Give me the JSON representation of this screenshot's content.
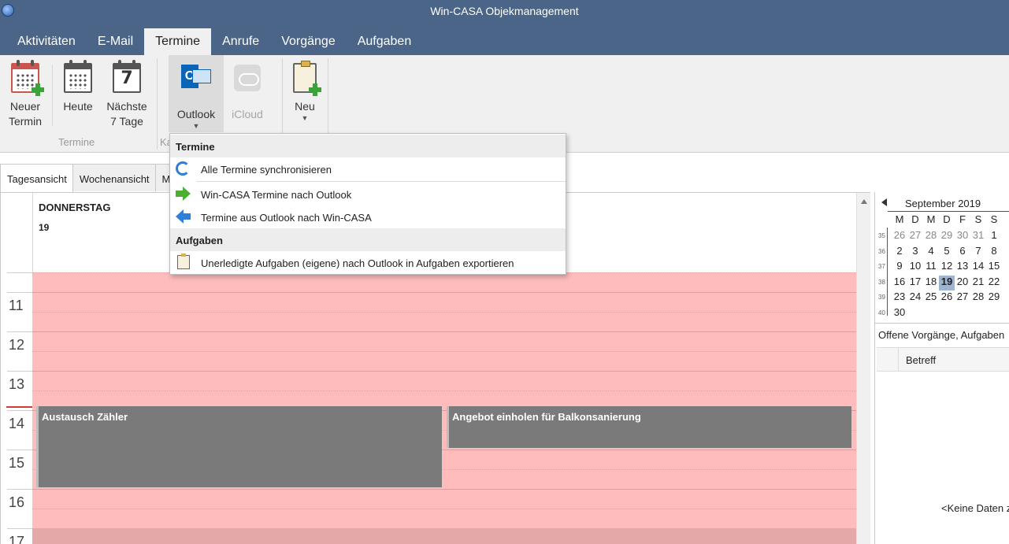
{
  "window": {
    "title": "Win-CASA Objekmanagement"
  },
  "tabs": [
    {
      "label": "Aktivitäten"
    },
    {
      "label": "E-Mail"
    },
    {
      "label": "Termine"
    },
    {
      "label": "Anrufe"
    },
    {
      "label": "Vorgänge"
    },
    {
      "label": "Aufgaben"
    }
  ],
  "ribbon": {
    "new_appointment": "Neuer Termin",
    "today": "Heute",
    "next7": "Nächste 7 Tage",
    "next7_icon_number": "7",
    "group_termine": "Termine",
    "outlook": "Outlook",
    "icloud": "iCloud",
    "group_partial": "Ka",
    "neu": "Neu"
  },
  "dropdown": {
    "section1": "Termine",
    "item_sync": "Alle Termine synchronisieren",
    "item_to_outlook": "Win-CASA Termine nach Outlook",
    "item_from_outlook": "Termine aus Outlook nach Win-CASA",
    "section2": "Aufgaben",
    "item_tasks_export": "Unerledigte Aufgaben (eigene) nach Outlook in Aufgaben exportieren"
  },
  "viewtabs": [
    {
      "label": "Tagesansicht"
    },
    {
      "label": "Wochenansicht"
    },
    {
      "label": "M"
    }
  ],
  "day": {
    "name": "DONNERSTAG",
    "number": "19",
    "hours": [
      "11",
      "12",
      "13",
      "14",
      "15",
      "16",
      "17"
    ]
  },
  "appointments": [
    {
      "title": "Austausch Zähler"
    },
    {
      "title": "Angebot einholen für Balkonsanierung"
    }
  ],
  "minicalendar": {
    "title": "September 2019",
    "weekdays": [
      "M",
      "D",
      "M",
      "D",
      "F",
      "S",
      "S"
    ],
    "weeks": [
      {
        "wk": "35",
        "days": [
          "26",
          "27",
          "28",
          "29",
          "30",
          "31",
          "1"
        ]
      },
      {
        "wk": "36",
        "days": [
          "2",
          "3",
          "4",
          "5",
          "6",
          "7",
          "8"
        ]
      },
      {
        "wk": "37",
        "days": [
          "9",
          "10",
          "11",
          "12",
          "13",
          "14",
          "15"
        ]
      },
      {
        "wk": "38",
        "days": [
          "16",
          "17",
          "18",
          "19",
          "20",
          "21",
          "22"
        ]
      },
      {
        "wk": "39",
        "days": [
          "23",
          "24",
          "25",
          "26",
          "27",
          "28",
          "29"
        ]
      },
      {
        "wk": "40",
        "days": [
          "30"
        ]
      }
    ],
    "today": "19"
  },
  "open_items": {
    "title": "Offene Vorgänge, Aufgaben",
    "column_betreff": "Betreff",
    "empty_text": "<Keine Daten z"
  },
  "colors": {
    "titlebar": "#4a6587",
    "slot_bg": "#ffbcbc",
    "appointment": "#7a7a7a",
    "today_highlight": "#9fb4cf"
  }
}
